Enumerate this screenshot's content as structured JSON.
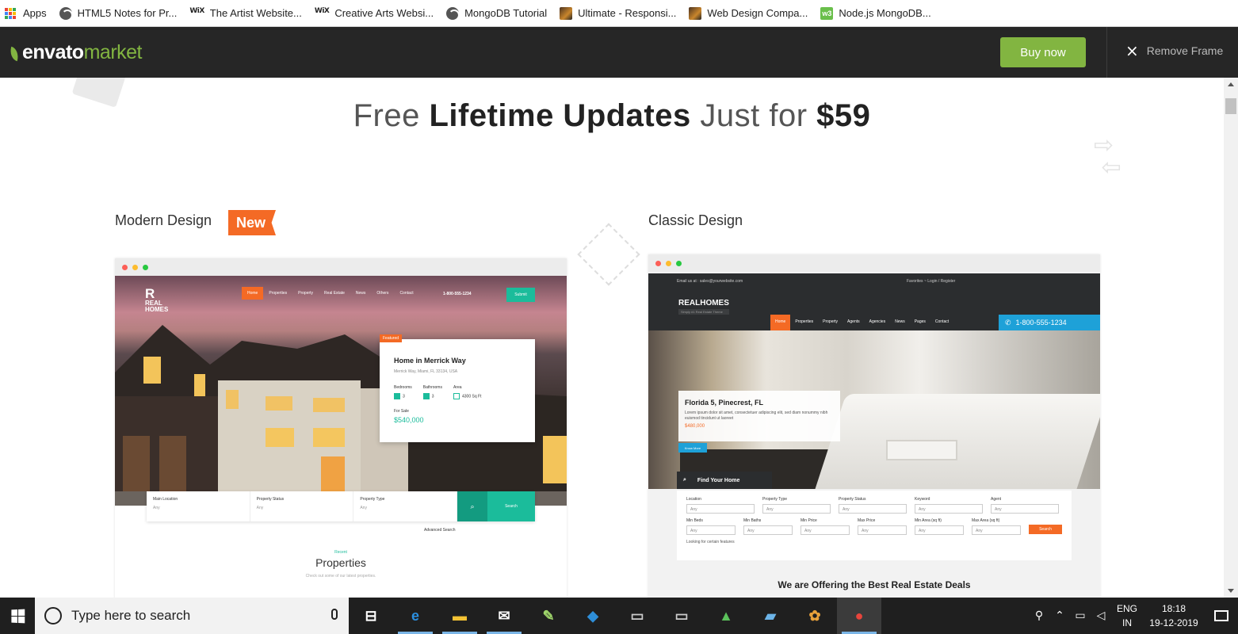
{
  "bookmarks": [
    {
      "label": "Apps",
      "icon": "apps-grid-icon"
    },
    {
      "label": "HTML5 Notes for Pr...",
      "icon": "globe-icon"
    },
    {
      "label": "The Artist Website...",
      "icon": "wix-icon"
    },
    {
      "label": "Creative Arts Websi...",
      "icon": "wix-icon"
    },
    {
      "label": "MongoDB Tutorial",
      "icon": "globe-icon"
    },
    {
      "label": "Ultimate - Responsi...",
      "icon": "thumbnail-icon"
    },
    {
      "label": "Web Design Compa...",
      "icon": "thumbnail-icon"
    },
    {
      "label": "Node.js MongoDB...",
      "icon": "w3schools-icon"
    }
  ],
  "wix_text": "WiX",
  "w3_text": "w3",
  "envato": {
    "logo_main": "envato",
    "logo_sub": "market",
    "buy_label": "Buy now",
    "remove_frame_label": "Remove Frame",
    "brand_color": "#82b541"
  },
  "headline": {
    "pre": "Free ",
    "bold": "Lifetime Updates",
    "mid": " Just for ",
    "price": "$59"
  },
  "modern": {
    "label": "Modern Design",
    "badge": "New",
    "logo_top": "REAL",
    "logo_bottom": "HOMES",
    "nav": [
      "Home",
      "Properties",
      "Property",
      "Real Estate",
      "News",
      "Others",
      "Contact"
    ],
    "phone": "1-800-555-1234",
    "submit": "Submit",
    "featured": "Featured",
    "card_title": "Home in Merrick Way",
    "card_address": "Merrick Way, Miami, FL 33134, USA",
    "bedrooms_label": "Bedrooms",
    "bedrooms": "3",
    "bathrooms_label": "Bathrooms",
    "bathrooms": "3",
    "area_label": "Area",
    "area": "4300 Sq Ft",
    "status": "For Sale",
    "price": "$540,000",
    "search_fields": [
      {
        "label": "Main Location",
        "value": "Any"
      },
      {
        "label": "Property Status",
        "value": "Any"
      },
      {
        "label": "Property Type",
        "value": "Any"
      }
    ],
    "search_label": "Search",
    "advanced": "Advanced Search",
    "recent_small": "Recent",
    "recent_title": "Properties",
    "recent_sub": "Check out some of our latest properties."
  },
  "classic": {
    "label": "Classic Design",
    "email": "Email us at : sales@yourwebsite.com",
    "top_right": "Favorites  ~   Login / Register",
    "logo": "REALHOMES",
    "tagline": "Simply #1 Real Estate Theme",
    "nav": [
      "Home",
      "Properties",
      "Property",
      "Agents",
      "Agencies",
      "News",
      "Pages",
      "Contact"
    ],
    "phone": "1-800-555-1234",
    "card_title": "Florida 5, Pinecrest, FL",
    "card_desc": "Lorem ipsum dolor sit amet, consectetuer adipiscing elit, sed diam nonummy nibh euismod tincidunt ut laoreet",
    "card_price": "$480,000",
    "know_more": "Know More",
    "find_home": "Find Your Home",
    "row1": [
      {
        "label": "Location",
        "value": "Any"
      },
      {
        "label": "Property Type",
        "value": "Any"
      },
      {
        "label": "Property Status",
        "value": "Any"
      },
      {
        "label": "Keyword",
        "value": "Any"
      },
      {
        "label": "Agent",
        "value": "Any"
      }
    ],
    "row2": [
      {
        "label": "Min Beds",
        "value": "Any"
      },
      {
        "label": "Min Baths",
        "value": "Any"
      },
      {
        "label": "Min Price",
        "value": "Any"
      },
      {
        "label": "Max Price",
        "value": "Any"
      },
      {
        "label": "Min Area (sq ft)",
        "value": "Any"
      },
      {
        "label": "Max Area (sq ft)",
        "value": "Any"
      }
    ],
    "search_label": "Search",
    "features": "Looking for certain features",
    "offer": "We are Offering the Best Real Estate Deals"
  },
  "taskbar": {
    "search_placeholder": "Type here to search",
    "apps": [
      {
        "icon": "task-view-icon",
        "glyph": "⊟",
        "color": "#ffffff"
      },
      {
        "icon": "edge-icon",
        "glyph": "e",
        "color": "#2b8fe0"
      },
      {
        "icon": "file-explorer-icon",
        "glyph": "▬",
        "color": "#f3c234"
      },
      {
        "icon": "mail-icon",
        "glyph": "✉",
        "color": "#ffffff"
      },
      {
        "icon": "notepad-icon",
        "glyph": "✎",
        "color": "#9fd56b"
      },
      {
        "icon": "vscode-icon",
        "glyph": "◆",
        "color": "#2e8ed8"
      },
      {
        "icon": "terminal-icon",
        "glyph": "▭",
        "color": "#cccccc"
      },
      {
        "icon": "terminal-icon-2",
        "glyph": "▭",
        "color": "#cccccc"
      },
      {
        "icon": "rocket-icon",
        "glyph": "▲",
        "color": "#5bc15b"
      },
      {
        "icon": "notebook-icon",
        "glyph": "▰",
        "color": "#6cb4e8"
      },
      {
        "icon": "paint-icon",
        "glyph": "✿",
        "color": "#e8a13a"
      },
      {
        "icon": "chrome-icon",
        "glyph": "●",
        "color": "#e8453c"
      }
    ],
    "lang_top": "ENG",
    "lang_bottom": "IN",
    "time": "18:18",
    "date": "19-12-2019"
  }
}
